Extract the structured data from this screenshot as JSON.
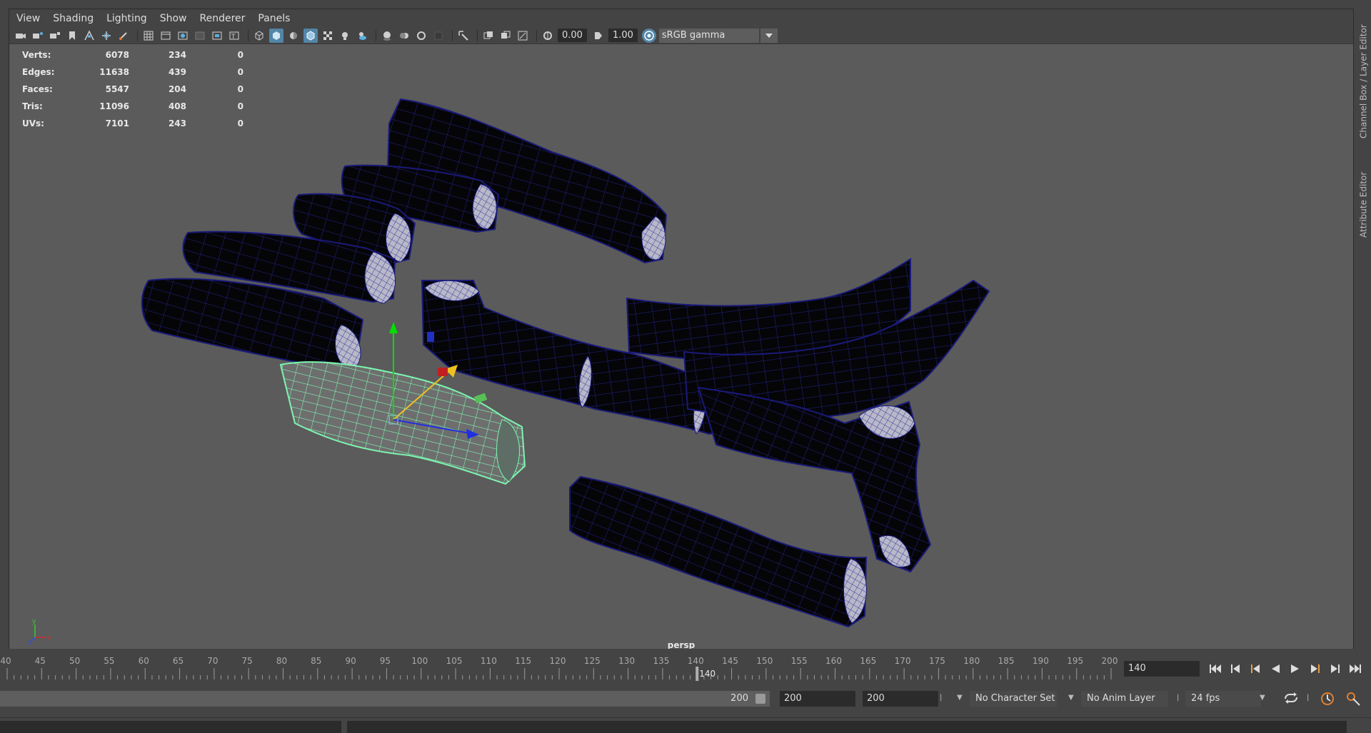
{
  "menubar": {
    "items": [
      "View",
      "Shading",
      "Lighting",
      "Show",
      "Renderer",
      "Panels"
    ]
  },
  "toolbar": {
    "exposure_value": "0.00",
    "gamma_value": "1.00",
    "color_space": "sRGB gamma"
  },
  "hud": {
    "rows": [
      {
        "label": "Verts:",
        "total": "6078",
        "selected": "234",
        "extra": "0"
      },
      {
        "label": "Edges:",
        "total": "11638",
        "selected": "439",
        "extra": "0"
      },
      {
        "label": "Faces:",
        "total": "5547",
        "selected": "204",
        "extra": "0"
      },
      {
        "label": "Tris:",
        "total": "11096",
        "selected": "408",
        "extra": "0"
      },
      {
        "label": "UVs:",
        "total": "7101",
        "selected": "243",
        "extra": "0"
      }
    ]
  },
  "viewport": {
    "camera_label": "persp",
    "axis_labels": {
      "y": "y",
      "x": "x",
      "z": "z"
    }
  },
  "side_tabs": {
    "channel_box": "Channel Box / Layer Editor",
    "attribute_editor": "Attribute Editor"
  },
  "timeline": {
    "tick_labels": [
      "40",
      "45",
      "50",
      "55",
      "60",
      "65",
      "70",
      "75",
      "80",
      "85",
      "90",
      "95",
      "100",
      "105",
      "110",
      "115",
      "120",
      "125",
      "130",
      "135",
      "140",
      "145",
      "150",
      "155",
      "160",
      "165",
      "170",
      "175",
      "180",
      "185",
      "190",
      "195",
      "200"
    ],
    "range_start": 40,
    "range_end": 200,
    "current_frame": 140,
    "current_frame_label": "140",
    "frame_field": "140"
  },
  "range_slider": {
    "end_label": "200",
    "start_field": "200",
    "end_field": "200",
    "character_set": "No Character Set",
    "anim_layer": "No Anim Layer",
    "fps": "24 fps"
  },
  "colors": {
    "mesh_wire": "#1a1a7a",
    "selected_wire": "#7cf5b0",
    "viewport_bg": "#5b5b5b",
    "active_icon": "#5285a6"
  }
}
